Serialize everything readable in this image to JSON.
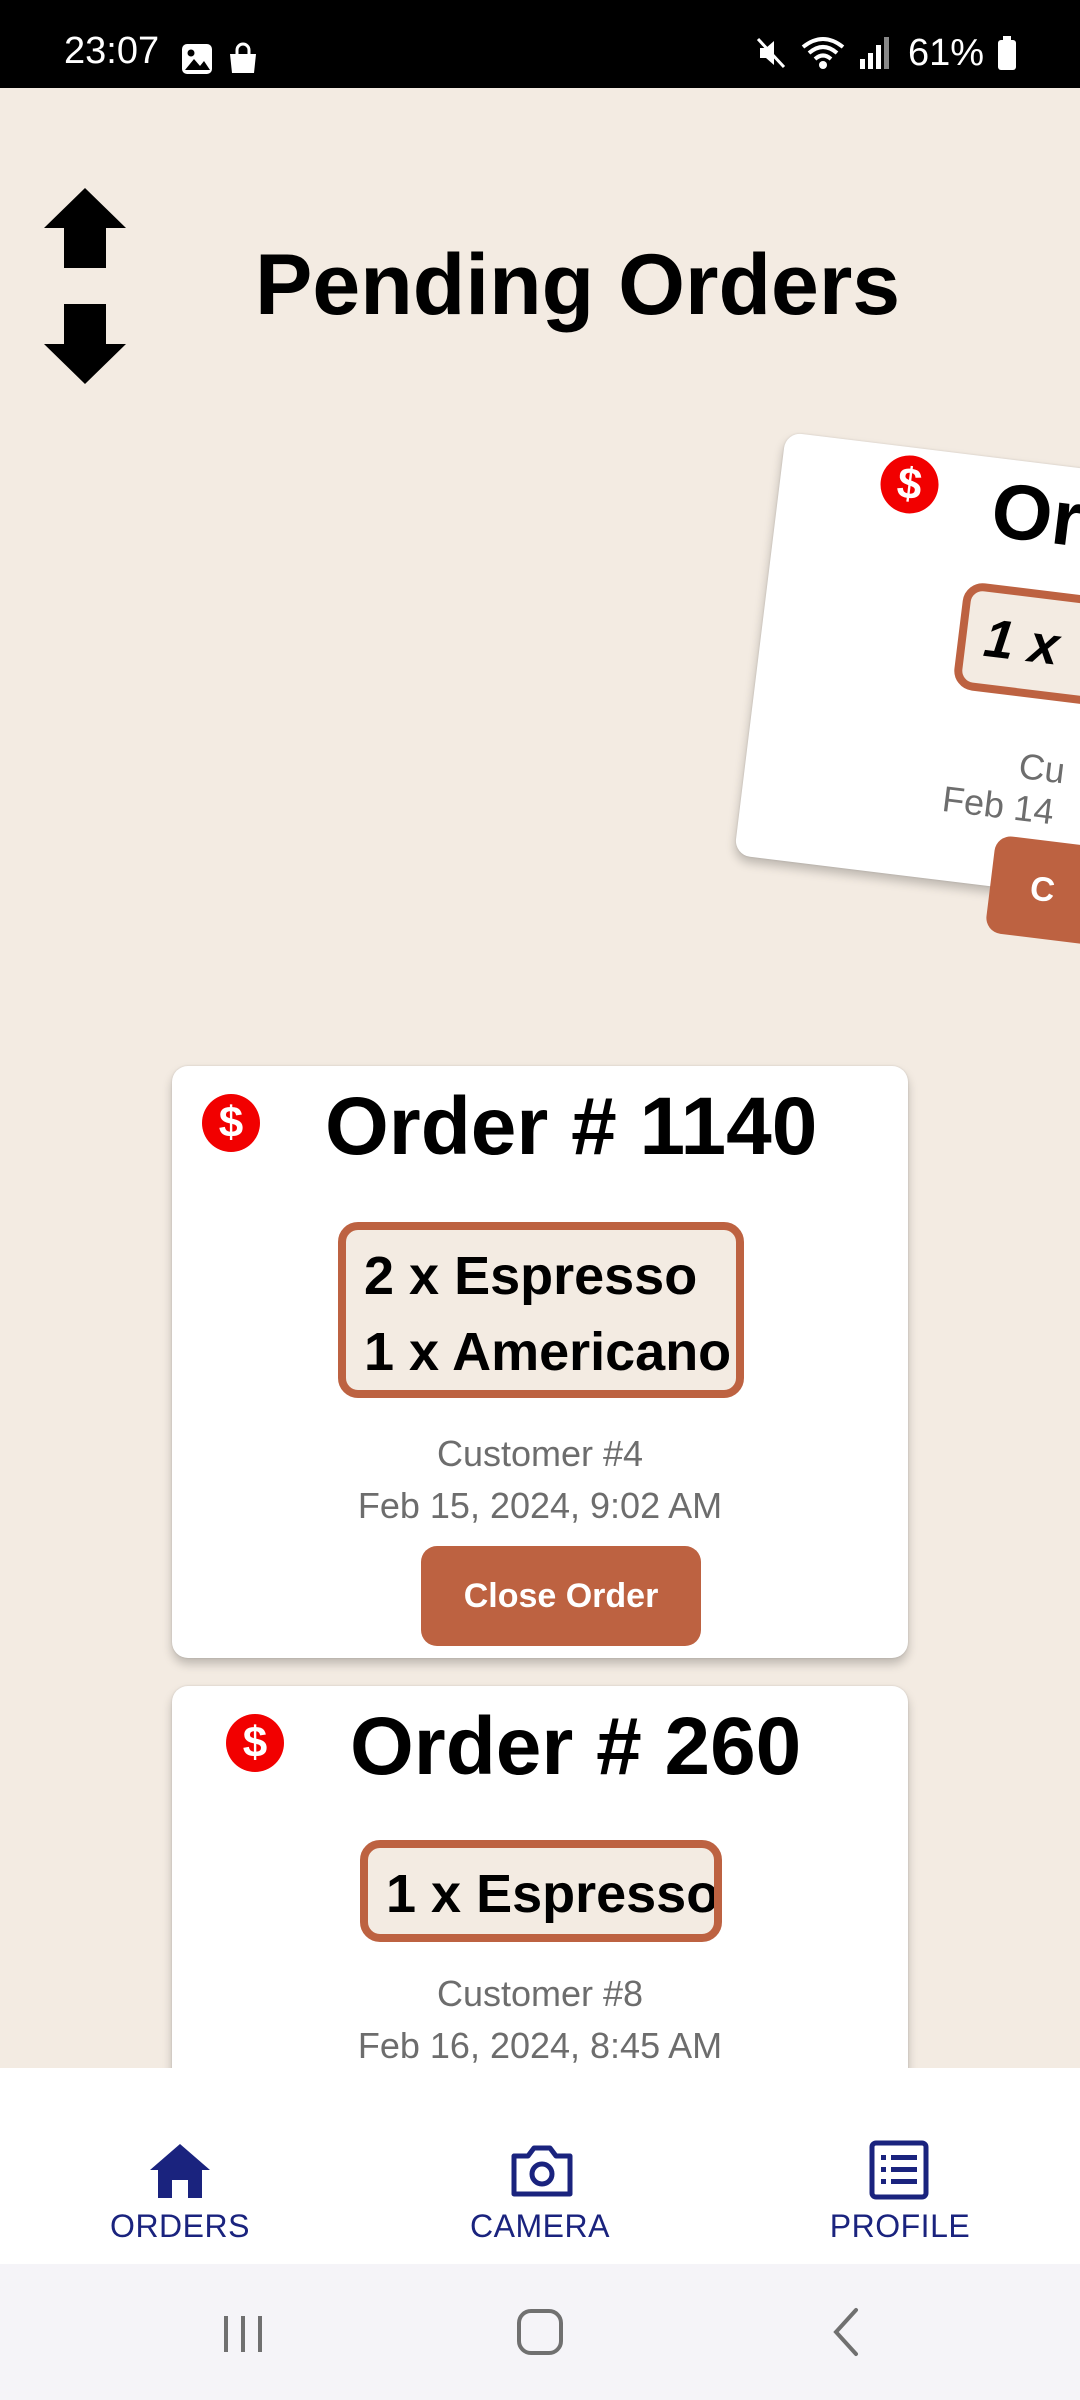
{
  "status_bar": {
    "time": "23:07",
    "battery": "61%",
    "icons": [
      "image-icon",
      "shopping-bag-icon",
      "mute-icon",
      "wifi-icon",
      "signal-icon",
      "battery-icon"
    ]
  },
  "header": {
    "title": "Pending Orders",
    "sort_icon": "sort-arrows-icon"
  },
  "orders": [
    {
      "title": "Order # 1140",
      "items": [
        "2 x Espresso",
        "1 x Americano"
      ],
      "customer": "Customer #4",
      "date": "Feb 15, 2024, 9:02 AM",
      "close_label": "Close Order",
      "paid_icon": "dollar-icon"
    },
    {
      "title": "Order # 260",
      "items": [
        "1 x Espresso"
      ],
      "customer": "Customer #8",
      "date": "Feb 16, 2024, 8:45 AM",
      "paid_icon": "dollar-icon"
    }
  ],
  "swiped_card": {
    "title_visible": "Or",
    "item_visible": "1 x",
    "customer_visible": "Cu",
    "date_visible": "Feb 14",
    "button_visible": "C"
  },
  "bottom_nav": {
    "orders": "ORDERS",
    "camera": "CAMERA",
    "profile": "PROFILE",
    "active_color": "#1a237e"
  },
  "colors": {
    "background": "#f3ebe2",
    "accent": "#bd6241",
    "paid_badge": "#f20000"
  }
}
